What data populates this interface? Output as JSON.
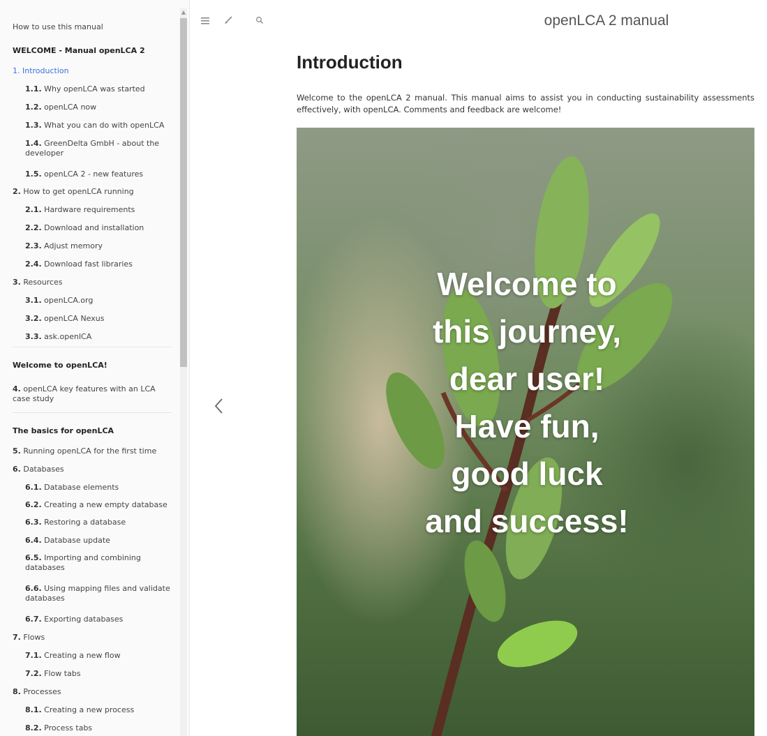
{
  "toolbar": {
    "icons": [
      "menu-icon",
      "brush-icon",
      "search-icon"
    ]
  },
  "book_title": "openLCA 2 manual",
  "page": {
    "title": "Introduction",
    "intro": "Welcome to the openLCA 2 manual. This manual aims to assist you in conducting sustainability assessments effectively, with openLCA. Comments and feedback are welcome!",
    "hero_lines": [
      "Welcome to",
      "this journey,",
      "dear user!",
      "Have fun,",
      "good luck",
      "and success!"
    ]
  },
  "sidebar": {
    "items": [
      {
        "num": "",
        "label": "How to use this manual"
      },
      {
        "num": "",
        "label": "WELCOME - Manual openLCA 2"
      },
      {
        "num": "1.",
        "label": "Introduction"
      },
      {
        "num": "1.1.",
        "label": "Why openLCA was started"
      },
      {
        "num": "1.2.",
        "label": "openLCA now"
      },
      {
        "num": "1.3.",
        "label": "What you can do with openLCA"
      },
      {
        "num": "1.4.",
        "label": "GreenDelta GmbH - about the developer"
      },
      {
        "num": "1.5.",
        "label": "openLCA 2 - new features"
      },
      {
        "num": "2.",
        "label": "How to get openLCA running"
      },
      {
        "num": "2.1.",
        "label": "Hardware requirements"
      },
      {
        "num": "2.2.",
        "label": "Download and installation"
      },
      {
        "num": "2.3.",
        "label": "Adjust memory"
      },
      {
        "num": "2.4.",
        "label": "Download fast libraries"
      },
      {
        "num": "3.",
        "label": "Resources"
      },
      {
        "num": "3.1.",
        "label": "openLCA.org"
      },
      {
        "num": "3.2.",
        "label": "openLCA Nexus"
      },
      {
        "num": "3.3.",
        "label": "ask.openlCA"
      },
      {
        "num": "",
        "label": "Welcome to openLCA!"
      },
      {
        "num": "4.",
        "label": "openLCA key features with an LCA case study"
      },
      {
        "num": "",
        "label": "The basics for openLCA"
      },
      {
        "num": "5.",
        "label": "Running openLCA for the first time"
      },
      {
        "num": "6.",
        "label": "Databases"
      },
      {
        "num": "6.1.",
        "label": "Database elements"
      },
      {
        "num": "6.2.",
        "label": "Creating a new empty database"
      },
      {
        "num": "6.3.",
        "label": "Restoring a database"
      },
      {
        "num": "6.4.",
        "label": "Database update"
      },
      {
        "num": "6.5.",
        "label": "Importing and combining databases"
      },
      {
        "num": "6.6.",
        "label": "Using mapping files and validate databases"
      },
      {
        "num": "6.7.",
        "label": "Exporting databases"
      },
      {
        "num": "7.",
        "label": "Flows"
      },
      {
        "num": "7.1.",
        "label": "Creating a new flow"
      },
      {
        "num": "7.2.",
        "label": "Flow tabs"
      },
      {
        "num": "8.",
        "label": "Processes"
      },
      {
        "num": "8.1.",
        "label": "Creating a new process"
      },
      {
        "num": "8.2.",
        "label": "Process tabs"
      }
    ]
  },
  "nav": {
    "prev_icon": "chevron-left-icon"
  }
}
